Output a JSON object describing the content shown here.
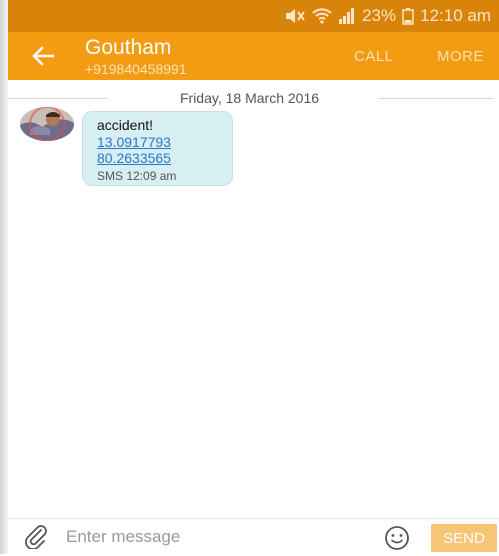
{
  "status_bar": {
    "battery": "23%",
    "time": "12:10 am",
    "icons": [
      "mute-icon",
      "wifi-icon",
      "signal-icon",
      "battery-icon"
    ]
  },
  "header": {
    "contact_name": "Goutham",
    "contact_number": "+919840458991",
    "call_label": "CALL",
    "more_label": "MORE",
    "back_icon": "back-arrow-icon"
  },
  "conversation": {
    "date_divider": "Friday, 18 March 2016",
    "messages": [
      {
        "text": "accident!",
        "links": [
          "13.0917793",
          "80.2633565"
        ],
        "meta": "SMS 12:09 am"
      }
    ]
  },
  "composer": {
    "placeholder": "Enter message",
    "send_label": "SEND",
    "icons": [
      "attach-icon",
      "emoji-icon"
    ]
  },
  "colors": {
    "status_bar": "#d8830a",
    "app_bar": "#f39c12",
    "bubble": "#d7eef2",
    "link": "#2a78c9",
    "send_button": "#f7c578"
  }
}
